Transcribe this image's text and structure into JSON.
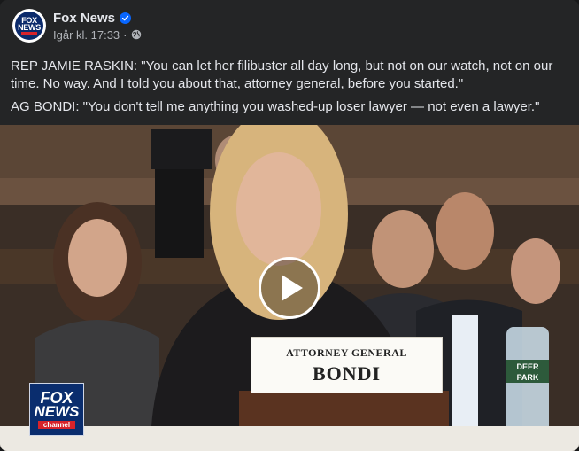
{
  "post": {
    "page_name": "Fox News",
    "timestamp": "Igår kl. 17:33",
    "separator": "·",
    "text_lines": [
      "REP JAMIE RASKIN: \"You can let her filibuster all day long, but not on our watch, not on our time. No way. And I told you about that, attorney general, before you started.\"",
      "AG BONDI: \"You don't tell me anything you washed-up loser lawyer — not even a lawyer.\""
    ]
  },
  "avatar": {
    "line1": "FOX",
    "line2": "NEWS"
  },
  "video": {
    "nameplate_title": "ATTORNEY GENERAL",
    "nameplate_name": "BONDI",
    "bug_line1": "FOX",
    "bug_line2": "NEWS",
    "bug_channel": "channel",
    "bottle_label1": "DEER",
    "bottle_label2": "PARK"
  },
  "icons": {
    "verified": "verified-badge-icon",
    "privacy": "globe-icon",
    "play": "play-icon"
  },
  "colors": {
    "accent_blue": "#0866ff",
    "fox_blue": "#0a2d6e",
    "fox_red": "#d8232a"
  }
}
